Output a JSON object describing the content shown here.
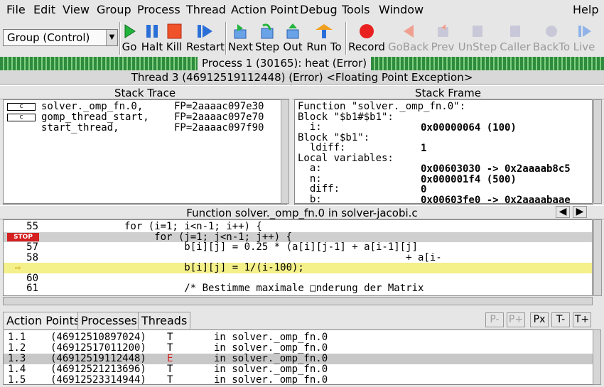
{
  "menu": [
    "File",
    "Edit",
    "View",
    "Group",
    "Process",
    "Thread",
    "Action Point",
    "Debug",
    "Tools",
    "Window"
  ],
  "menu_help": "Help",
  "group_select": "Group (Control)",
  "toolbar": [
    {
      "label": "Go",
      "icon": "go-icon",
      "enabled": true
    },
    {
      "label": "Halt",
      "icon": "halt-icon",
      "enabled": true
    },
    {
      "label": "Kill",
      "icon": "kill-icon",
      "enabled": true
    },
    {
      "label": "Restart",
      "icon": "restart-icon",
      "enabled": true
    },
    {
      "label": "Next",
      "icon": "next-icon",
      "enabled": true
    },
    {
      "label": "Step",
      "icon": "step-icon",
      "enabled": true
    },
    {
      "label": "Out",
      "icon": "out-icon",
      "enabled": true
    },
    {
      "label": "Run To",
      "icon": "run-to-icon",
      "enabled": true
    },
    {
      "label": "Record",
      "icon": "record-icon",
      "enabled": true
    },
    {
      "label": "GoBack",
      "icon": "goback-icon",
      "enabled": false
    },
    {
      "label": "Prev",
      "icon": "prev-icon",
      "enabled": false
    },
    {
      "label": "UnStep",
      "icon": "unstep-icon",
      "enabled": false
    },
    {
      "label": "Caller",
      "icon": "caller-icon",
      "enabled": false
    },
    {
      "label": "BackTo",
      "icon": "backto-icon",
      "enabled": false
    },
    {
      "label": "Live",
      "icon": "live-icon",
      "enabled": false
    }
  ],
  "process_status": "Process 1 (30165): heat (Error)",
  "thread_status": "Thread 3 (46912519112448) (Error) <Floating Point Exception>",
  "stack_trace": {
    "title": "Stack Trace",
    "rows": [
      {
        "lang": "c",
        "func": "solver._omp_fn.0,",
        "fp": "FP=2aaaac097e30"
      },
      {
        "lang": "c",
        "func": "gomp_thread_start,",
        "fp": "FP=2aaaac097e70"
      },
      {
        "lang": "",
        "func": "start_thread,",
        "fp": "FP=2aaaac097f90"
      }
    ]
  },
  "stack_frame": {
    "title": "Stack Frame",
    "lines": [
      {
        "label": "Function \"solver._omp_fn.0\":",
        "value": ""
      },
      {
        "label": "Block \"$b1#$b1\":",
        "value": ""
      },
      {
        "label": "  i:",
        "value": "0x00000064 (100)"
      },
      {
        "label": "Block \"$b1\":",
        "value": ""
      },
      {
        "label": "  ldiff:",
        "value": "1"
      },
      {
        "label": "Local variables:",
        "value": ""
      },
      {
        "label": "  a:",
        "value": "0x00603030 -> 0x2aaaab8c5"
      },
      {
        "label": "  n:",
        "value": "0x000001f4 (500)"
      },
      {
        "label": "  diff:",
        "value": "0"
      },
      {
        "label": "  b:",
        "value": "0x00603fe0 -> 0x2aaaabaae"
      }
    ]
  },
  "source": {
    "title": "Function solver._omp_fn.0 in solver-jacobi.c",
    "lines": [
      {
        "num": "55",
        "code": "              for (i=1; i<n-1; i++) {",
        "kind": "normal"
      },
      {
        "num": "STOP",
        "code": "                   for (j=1; j<n-1; j++) {",
        "kind": "active"
      },
      {
        "num": "57",
        "code": "                        b[i][j] = 0.25 * (a[i][j-1] + a[i-1][j]",
        "kind": "normal"
      },
      {
        "num": "58",
        "code": "                                                             + a[i-",
        "kind": "normal"
      },
      {
        "num": "",
        "code": "                        b[i][j] = 1/(i-100);",
        "kind": "pc"
      },
      {
        "num": "60",
        "code": "",
        "kind": "normal"
      },
      {
        "num": "61",
        "code": "                        /* Bestimme maximale □nderung der Matrix",
        "kind": "normal"
      }
    ]
  },
  "tabs": [
    "Action Points",
    "Processes",
    "Threads"
  ],
  "tab_buttons": [
    {
      "label": "P-",
      "enabled": false
    },
    {
      "label": "P+",
      "enabled": false
    },
    {
      "label": "Px",
      "enabled": true
    },
    {
      "label": "T-",
      "enabled": true
    },
    {
      "label": "T+",
      "enabled": true
    }
  ],
  "threads": [
    {
      "id": "1.1",
      "tid": "(46912510897024)",
      "state": "T",
      "loc": "in solver._omp_fn.0",
      "selected": false
    },
    {
      "id": "1.2",
      "tid": "(46912517011200)",
      "state": "T",
      "loc": "in solver._omp_fn.0",
      "selected": false
    },
    {
      "id": "1.3",
      "tid": "(46912519112448)",
      "state": "E",
      "loc": "in solver._omp_fn.0",
      "selected": true
    },
    {
      "id": "1.4",
      "tid": "(46912521213696)",
      "state": "T",
      "loc": "in solver._omp_fn.0",
      "selected": false
    },
    {
      "id": "1.5",
      "tid": "(46912523314944)",
      "state": "T",
      "loc": "in solver._omp_fn.0",
      "selected": false
    }
  ],
  "colors": {
    "error_state": "#d42020",
    "pc_highlight": "#f4f08a",
    "process_bar": "#2e8b3e"
  }
}
